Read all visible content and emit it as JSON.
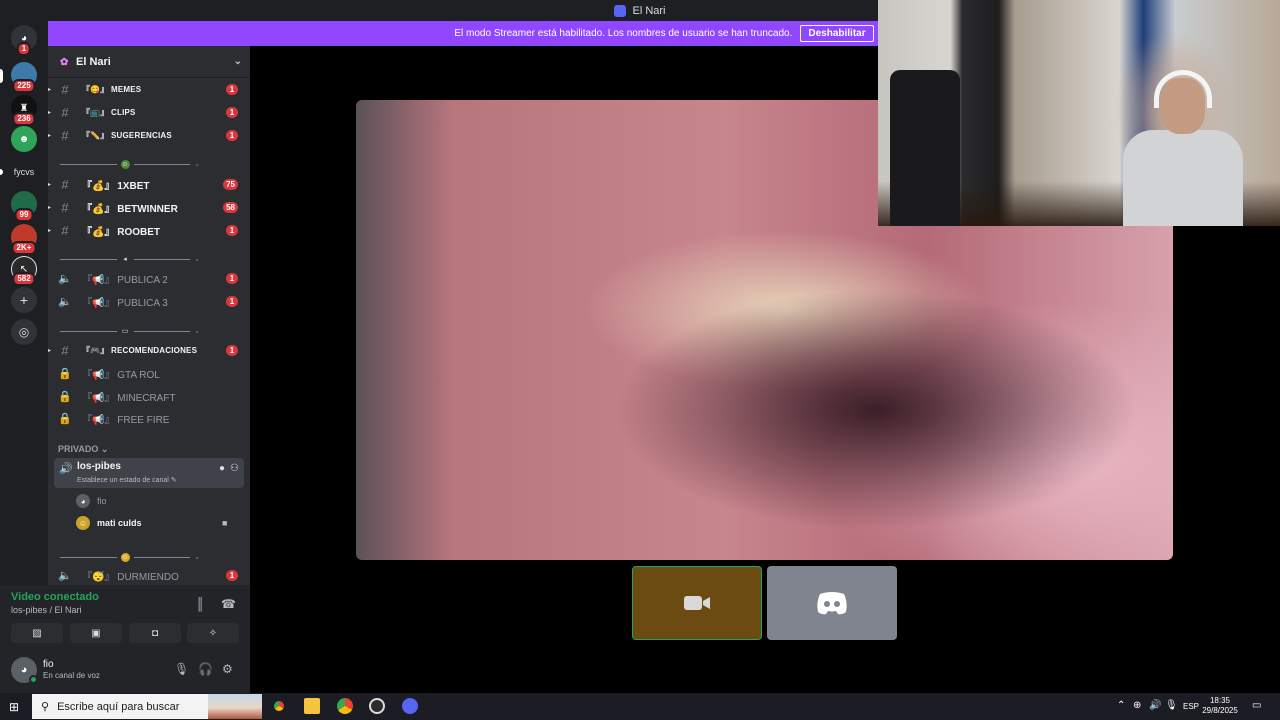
{
  "window": {
    "title": "El Nari"
  },
  "streamer_banner": {
    "text": "El modo Streamer está habilitado. Los nombres de usuario se han truncado.",
    "button": "Deshabilitar"
  },
  "guilds": [
    {
      "badge": "1"
    },
    {
      "badge": "225"
    },
    {
      "badge": "236"
    },
    {
      "badge": ""
    },
    {
      "label": "fycvs"
    },
    {
      "badge": "99"
    },
    {
      "badge": "2K+"
    },
    {
      "badge": "582"
    }
  ],
  "server": {
    "name": "El Nari"
  },
  "channels": [
    {
      "type": "text",
      "name": "MEMES",
      "prefix": "『😋』",
      "count": "1"
    },
    {
      "type": "text",
      "name": "CLIPS",
      "prefix": "『📺』",
      "count": "1"
    },
    {
      "type": "text",
      "name": "SUGERENCIAS",
      "prefix": "『✏️』",
      "count": "1"
    },
    {
      "type": "text",
      "name": "1XBET",
      "prefix": "『💰』",
      "count": "75"
    },
    {
      "type": "text",
      "name": "BETWINNER",
      "prefix": "『💰』",
      "count": "58"
    },
    {
      "type": "text",
      "name": "ROOBET",
      "prefix": "『💰』",
      "count": "1"
    },
    {
      "type": "voice",
      "name": "PUBLICA 2",
      "prefix": "『📢』",
      "count": "1"
    },
    {
      "type": "voice",
      "name": "PUBLICA 3",
      "prefix": "『📢』",
      "count": "1"
    },
    {
      "type": "text",
      "name": "RECOMENDACIONES",
      "prefix": "『🎮』",
      "count": "1"
    },
    {
      "type": "locked",
      "name": "GTA ROL",
      "prefix": "『📢』",
      "count": ""
    },
    {
      "type": "locked",
      "name": "MINECRAFT",
      "prefix": "『📢』",
      "count": ""
    },
    {
      "type": "locked",
      "name": "FREE FIRE",
      "prefix": "『📢』",
      "count": ""
    },
    {
      "type": "voice",
      "name": "DURMIENDO",
      "prefix": "『😴』",
      "count": "1"
    }
  ],
  "category": {
    "label": "PRIVADO ⌄"
  },
  "voice_channel": {
    "name": "los-pibes",
    "status": "Establece un estado de canal ✎"
  },
  "voice_users": [
    {
      "name": "fio"
    },
    {
      "name": "mati culds"
    }
  ],
  "rtc": {
    "status": "Video conectado",
    "location": "los-pibes / El Nari"
  },
  "user_panel": {
    "name": "fio",
    "status": "En canal de voz"
  },
  "taskbar": {
    "search_placeholder": "Escribe aquí para buscar",
    "lang": "ESP",
    "time": "18:35",
    "date": "29/8/2025"
  },
  "colors": {
    "streamer_banner": "#9147ff",
    "badge": "#da373c",
    "connected": "#23a55a",
    "blurple": "#5865f2"
  }
}
